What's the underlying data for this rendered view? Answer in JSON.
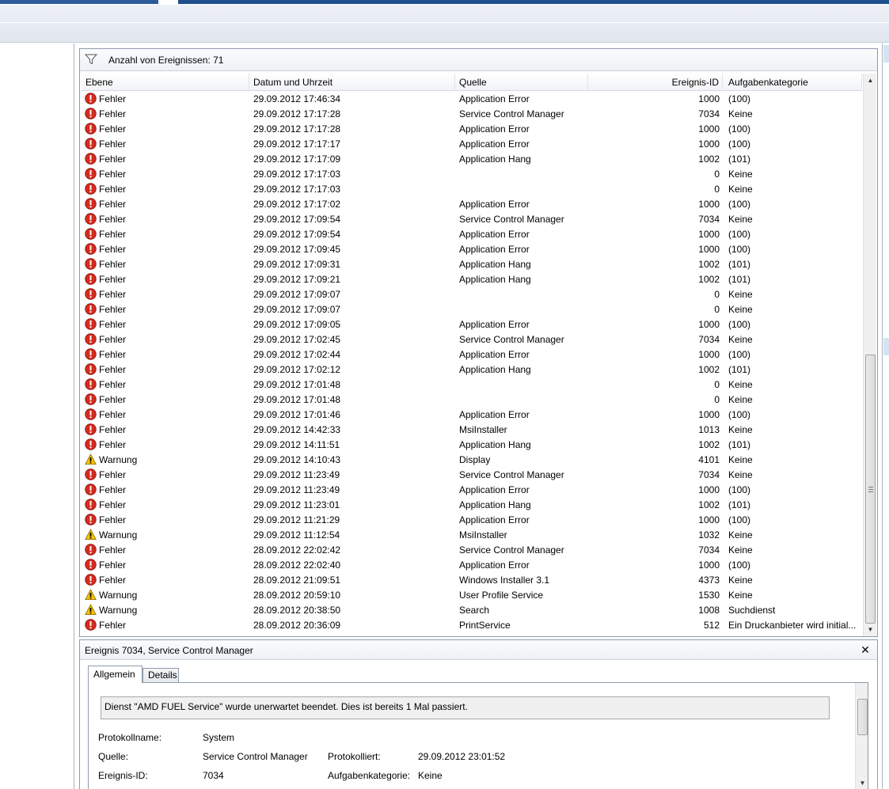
{
  "filter": {
    "count_label": "Anzahl von Ereignissen: 71"
  },
  "columns": {
    "level": "Ebene",
    "date": "Datum und Uhrzeit",
    "source": "Quelle",
    "id": "Ereignis-ID",
    "category": "Aufgabenkategorie"
  },
  "events": [
    {
      "level": "Fehler",
      "date": "29.09.2012 17:46:34",
      "source": "Application Error",
      "id": "1000",
      "category": "(100)"
    },
    {
      "level": "Fehler",
      "date": "29.09.2012 17:17:28",
      "source": "Service Control Manager",
      "id": "7034",
      "category": "Keine"
    },
    {
      "level": "Fehler",
      "date": "29.09.2012 17:17:28",
      "source": "Application Error",
      "id": "1000",
      "category": "(100)"
    },
    {
      "level": "Fehler",
      "date": "29.09.2012 17:17:17",
      "source": "Application Error",
      "id": "1000",
      "category": "(100)"
    },
    {
      "level": "Fehler",
      "date": "29.09.2012 17:17:09",
      "source": "Application Hang",
      "id": "1002",
      "category": "(101)"
    },
    {
      "level": "Fehler",
      "date": "29.09.2012 17:17:03",
      "source": "",
      "id": "0",
      "category": "Keine"
    },
    {
      "level": "Fehler",
      "date": "29.09.2012 17:17:03",
      "source": "",
      "id": "0",
      "category": "Keine"
    },
    {
      "level": "Fehler",
      "date": "29.09.2012 17:17:02",
      "source": "Application Error",
      "id": "1000",
      "category": "(100)"
    },
    {
      "level": "Fehler",
      "date": "29.09.2012 17:09:54",
      "source": "Service Control Manager",
      "id": "7034",
      "category": "Keine"
    },
    {
      "level": "Fehler",
      "date": "29.09.2012 17:09:54",
      "source": "Application Error",
      "id": "1000",
      "category": "(100)"
    },
    {
      "level": "Fehler",
      "date": "29.09.2012 17:09:45",
      "source": "Application Error",
      "id": "1000",
      "category": "(100)"
    },
    {
      "level": "Fehler",
      "date": "29.09.2012 17:09:31",
      "source": "Application Hang",
      "id": "1002",
      "category": "(101)"
    },
    {
      "level": "Fehler",
      "date": "29.09.2012 17:09:21",
      "source": "Application Hang",
      "id": "1002",
      "category": "(101)"
    },
    {
      "level": "Fehler",
      "date": "29.09.2012 17:09:07",
      "source": "",
      "id": "0",
      "category": "Keine"
    },
    {
      "level": "Fehler",
      "date": "29.09.2012 17:09:07",
      "source": "",
      "id": "0",
      "category": "Keine"
    },
    {
      "level": "Fehler",
      "date": "29.09.2012 17:09:05",
      "source": "Application Error",
      "id": "1000",
      "category": "(100)"
    },
    {
      "level": "Fehler",
      "date": "29.09.2012 17:02:45",
      "source": "Service Control Manager",
      "id": "7034",
      "category": "Keine"
    },
    {
      "level": "Fehler",
      "date": "29.09.2012 17:02:44",
      "source": "Application Error",
      "id": "1000",
      "category": "(100)"
    },
    {
      "level": "Fehler",
      "date": "29.09.2012 17:02:12",
      "source": "Application Hang",
      "id": "1002",
      "category": "(101)"
    },
    {
      "level": "Fehler",
      "date": "29.09.2012 17:01:48",
      "source": "",
      "id": "0",
      "category": "Keine"
    },
    {
      "level": "Fehler",
      "date": "29.09.2012 17:01:48",
      "source": "",
      "id": "0",
      "category": "Keine"
    },
    {
      "level": "Fehler",
      "date": "29.09.2012 17:01:46",
      "source": "Application Error",
      "id": "1000",
      "category": "(100)"
    },
    {
      "level": "Fehler",
      "date": "29.09.2012 14:42:33",
      "source": "MsiInstaller",
      "id": "1013",
      "category": "Keine"
    },
    {
      "level": "Fehler",
      "date": "29.09.2012 14:11:51",
      "source": "Application Hang",
      "id": "1002",
      "category": "(101)"
    },
    {
      "level": "Warnung",
      "date": "29.09.2012 14:10:43",
      "source": "Display",
      "id": "4101",
      "category": "Keine"
    },
    {
      "level": "Fehler",
      "date": "29.09.2012 11:23:49",
      "source": "Service Control Manager",
      "id": "7034",
      "category": "Keine"
    },
    {
      "level": "Fehler",
      "date": "29.09.2012 11:23:49",
      "source": "Application Error",
      "id": "1000",
      "category": "(100)"
    },
    {
      "level": "Fehler",
      "date": "29.09.2012 11:23:01",
      "source": "Application Hang",
      "id": "1002",
      "category": "(101)"
    },
    {
      "level": "Fehler",
      "date": "29.09.2012 11:21:29",
      "source": "Application Error",
      "id": "1000",
      "category": "(100)"
    },
    {
      "level": "Warnung",
      "date": "29.09.2012 11:12:54",
      "source": "MsiInstaller",
      "id": "1032",
      "category": "Keine"
    },
    {
      "level": "Fehler",
      "date": "28.09.2012 22:02:42",
      "source": "Service Control Manager",
      "id": "7034",
      "category": "Keine"
    },
    {
      "level": "Fehler",
      "date": "28.09.2012 22:02:40",
      "source": "Application Error",
      "id": "1000",
      "category": "(100)"
    },
    {
      "level": "Fehler",
      "date": "28.09.2012 21:09:51",
      "source": "Windows Installer 3.1",
      "id": "4373",
      "category": "Keine"
    },
    {
      "level": "Warnung",
      "date": "28.09.2012 20:59:10",
      "source": "User Profile Service",
      "id": "1530",
      "category": "Keine"
    },
    {
      "level": "Warnung",
      "date": "28.09.2012 20:38:50",
      "source": "Search",
      "id": "1008",
      "category": "Suchdienst"
    },
    {
      "level": "Fehler",
      "date": "28.09.2012 20:36:09",
      "source": "PrintService",
      "id": "512",
      "category": "Ein Druckanbieter wird initial..."
    }
  ],
  "detail": {
    "title": "Ereignis 7034, Service Control Manager",
    "tabs": [
      "Allgemein",
      "Details"
    ],
    "description": "Dienst \"AMD FUEL Service\" wurde unerwartet beendet. Dies ist bereits 1 Mal passiert.",
    "fields": {
      "log_name_label": "Protokollname:",
      "log_name": "System",
      "source_label": "Quelle:",
      "source": "Service Control Manager",
      "logged_label": "Protokolliert:",
      "logged": "29.09.2012 23:01:52",
      "event_id_label": "Ereignis-ID:",
      "event_id": "7034",
      "task_label": "Aufgabenkategorie:",
      "task": "Keine"
    }
  },
  "colors": {
    "error": "#d52b1e",
    "warning": "#f5c400",
    "border": "#8e9aaa"
  },
  "icons": {
    "error": "error-icon",
    "warning": "warning-icon",
    "filter": "filter-icon",
    "close": "close-icon"
  }
}
